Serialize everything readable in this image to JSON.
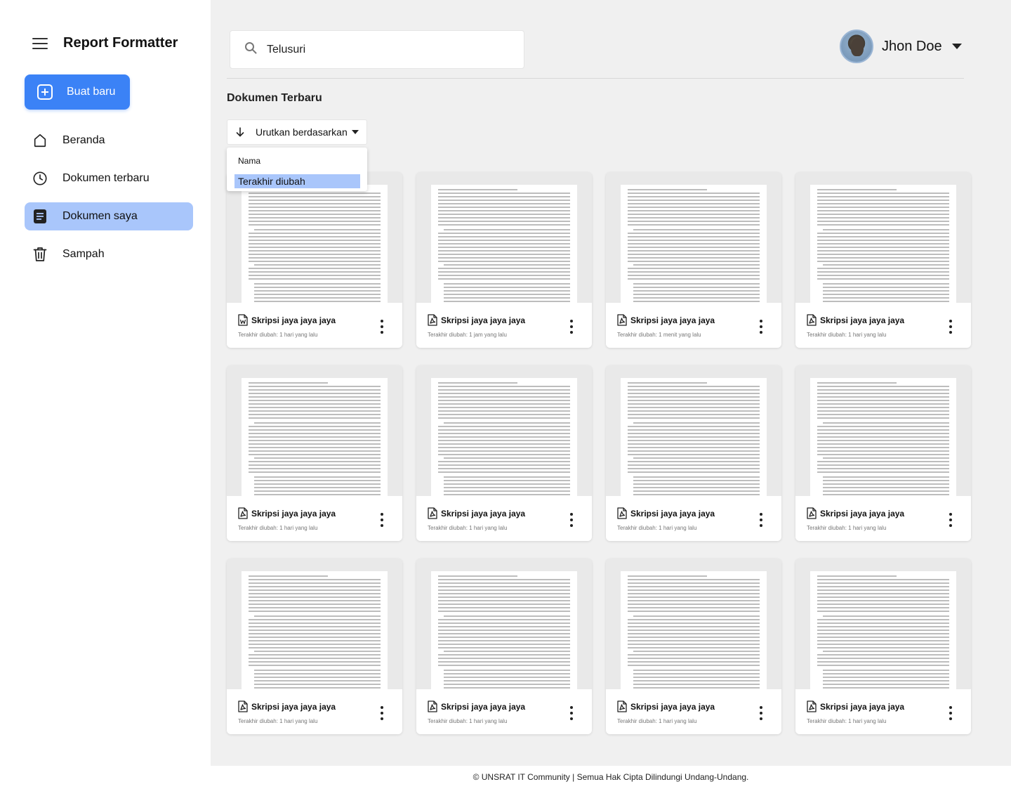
{
  "app": {
    "title": "Report Formatter",
    "new_button_label": "Buat baru"
  },
  "sidebar": {
    "items": [
      {
        "label": "Beranda",
        "icon": "home-icon",
        "active": false
      },
      {
        "label": "Dokumen terbaru",
        "icon": "clock-icon",
        "active": false
      },
      {
        "label": "Dokumen saya",
        "icon": "document-icon",
        "active": true
      },
      {
        "label": "Sampah",
        "icon": "trash-icon",
        "active": false
      }
    ]
  },
  "header": {
    "search_placeholder": "Telusuri",
    "search_value": "",
    "user_name": "Jhon Doe"
  },
  "main": {
    "section_title": "Dokumen Terbaru",
    "sort_label": "Urutkan berdasarkan",
    "sort_options": [
      {
        "label": "Nama",
        "selected": false
      },
      {
        "label": "Terakhir diubah",
        "selected": true
      }
    ],
    "documents": [
      {
        "title": "Skripsi jaya jaya jaya",
        "modified": "Terakhir diubah: 1 hari yang lalu",
        "file_icon": "word-file-icon"
      },
      {
        "title": "Skripsi jaya jaya jaya",
        "modified": "Terakhir diubah: 1 jam yang lalu",
        "file_icon": "pdf-file-icon"
      },
      {
        "title": "Skripsi jaya jaya jaya",
        "modified": "Terakhir diubah: 1 menit yang lalu",
        "file_icon": "pdf-file-icon"
      },
      {
        "title": "Skripsi jaya jaya jaya",
        "modified": "Terakhir diubah: 1 hari yang lalu",
        "file_icon": "pdf-file-icon"
      },
      {
        "title": "Skripsi jaya jaya jaya",
        "modified": "Terakhir diubah: 1 hari yang lalu",
        "file_icon": "pdf-file-icon"
      },
      {
        "title": "Skripsi jaya jaya jaya",
        "modified": "Terakhir diubah: 1 hari yang lalu",
        "file_icon": "pdf-file-icon"
      },
      {
        "title": "Skripsi jaya jaya jaya",
        "modified": "Terakhir diubah: 1 hari yang lalu",
        "file_icon": "pdf-file-icon"
      },
      {
        "title": "Skripsi jaya jaya jaya",
        "modified": "Terakhir diubah: 1 hari yang lalu",
        "file_icon": "pdf-file-icon"
      },
      {
        "title": "Skripsi jaya jaya jaya",
        "modified": "Terakhir diubah: 1 hari yang lalu",
        "file_icon": "pdf-file-icon"
      },
      {
        "title": "Skripsi jaya jaya jaya",
        "modified": "Terakhir diubah: 1 hari yang lalu",
        "file_icon": "pdf-file-icon"
      },
      {
        "title": "Skripsi jaya jaya jaya",
        "modified": "Terakhir diubah: 1 hari yang lalu",
        "file_icon": "pdf-file-icon"
      },
      {
        "title": "Skripsi jaya jaya jaya",
        "modified": "Terakhir diubah: 1 hari yang lalu",
        "file_icon": "pdf-file-icon"
      }
    ]
  },
  "footer": {
    "text": "© UNSRAT IT Community | Semua Hak Cipta Dilindungi Undang-Undang."
  },
  "colors": {
    "accent": "#3b82f6",
    "active_nav": "#a9c6fb",
    "main_bg": "#f0f0f0"
  }
}
